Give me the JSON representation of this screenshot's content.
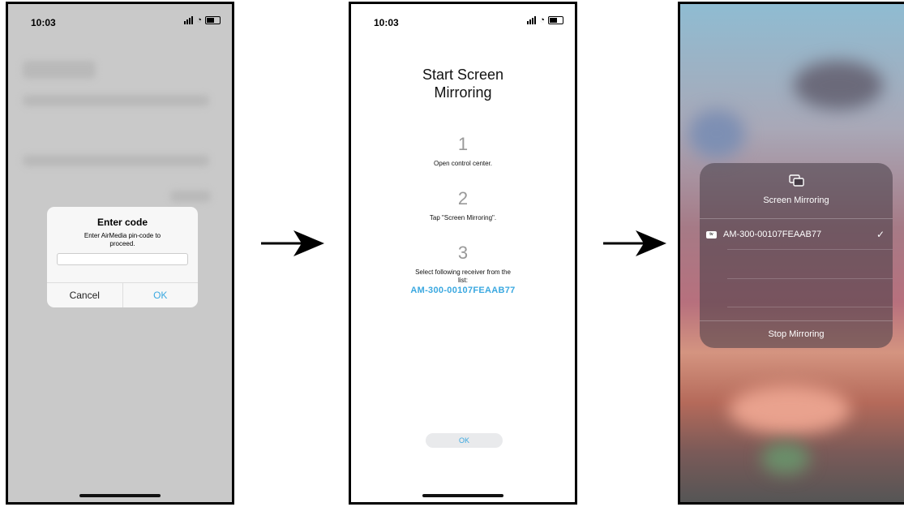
{
  "phone1": {
    "time": "10:03",
    "dialog": {
      "title": "Enter code",
      "message": "Enter AirMedia pin-code to proceed.",
      "input_value": "",
      "cancel_label": "Cancel",
      "ok_label": "OK"
    }
  },
  "phone2": {
    "time": "10:03",
    "title": "Start Screen Mirroring",
    "steps": [
      {
        "number": "1",
        "text": "Open control center."
      },
      {
        "number": "2",
        "text": "Tap \"Screen Mirroring\"."
      },
      {
        "number": "3",
        "text": "Select following receiver from the list:"
      }
    ],
    "receiver": "AM-300-00107FEAAB77",
    "ok_label": "OK"
  },
  "phone3": {
    "panel_title": "Screen Mirroring",
    "device_badge": "tv",
    "device_name": "AM-300-00107FEAAB77",
    "checkmark": "✓",
    "stop_label": "Stop Mirroring"
  },
  "colors": {
    "accent": "#3aa8e0"
  }
}
